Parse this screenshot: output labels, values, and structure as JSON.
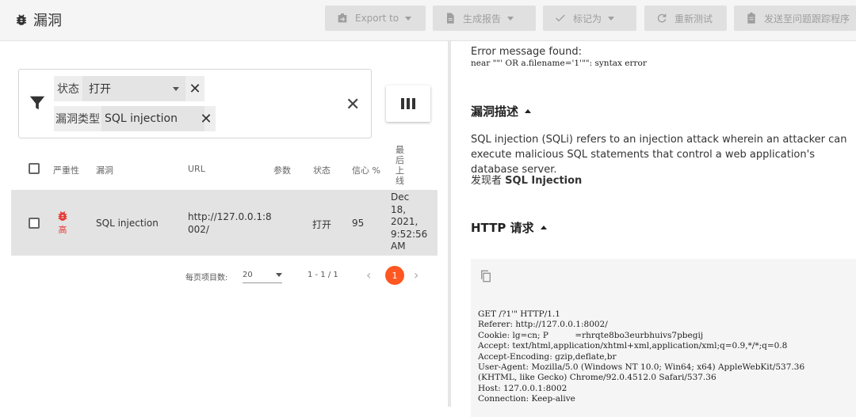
{
  "header": {
    "title": "漏洞",
    "buttons": [
      {
        "label": "Export to",
        "icon": "export-icon"
      },
      {
        "label": "生成报告",
        "icon": "report-icon"
      },
      {
        "label": "标记为",
        "icon": "check-icon"
      },
      {
        "label": "重新测试",
        "icon": "retest-icon"
      },
      {
        "label": "发送至问题跟踪程序",
        "icon": "clipboard-icon"
      }
    ]
  },
  "filters": {
    "status_label": "状态",
    "status_value": "打开",
    "type_label": "漏洞类型",
    "type_value": "SQL injection"
  },
  "table": {
    "columns": [
      "严重性",
      "漏洞",
      "URL",
      "参数",
      "状态",
      "信心 %",
      "最\n后\n上\n线"
    ],
    "rows": [
      {
        "severity": "高",
        "vulnerability": "SQL injection",
        "url": "http://127.0.0.1:8\n002/",
        "param": "",
        "status": "打开",
        "confidence": "95",
        "last_seen": "Dec\n18,\n2021,\n9:52:56\nAM"
      }
    ]
  },
  "pager": {
    "per_page_label": "每页项目数:",
    "per_page_value": "20",
    "range": "1 - 1 / 1",
    "current_page": "1"
  },
  "details": {
    "error_heading": "Error message found:",
    "error_text": "near \"\"' OR a.filename='1'\"\": syntax error",
    "desc_title": "漏洞描述",
    "desc_text": "SQL injection (SQLi) refers to an injection attack wherein an attacker can execute malicious SQL statements that control a web application's database server.",
    "found_by_label": "发现者",
    "found_by_value": "SQL Injection",
    "http_title": "HTTP 请求",
    "request_lines": [
      "GET /?1'\" HTTP/1.1",
      "Referer: http://127.0.0.1:8002/",
      "Cookie: lg=cn; P          =rhrqte8bo3eurbhuivs7pbegij",
      "Accept: text/html,application/xhtml+xml,application/xml;q=0.9,*/*;q=0.8",
      "Accept-Encoding: gzip,deflate,br",
      "User-Agent: Mozilla/5.0 (Windows NT 10.0; Win64; x64) AppleWebKit/537.36",
      "(KHTML, like Gecko) Chrome/92.0.4512.0 Safari/537.36",
      "Host: 127.0.0.1:8002",
      "Connection: Keep-alive"
    ]
  },
  "colors": {
    "accent": "#ff5722",
    "severity_high": "#e53935"
  }
}
